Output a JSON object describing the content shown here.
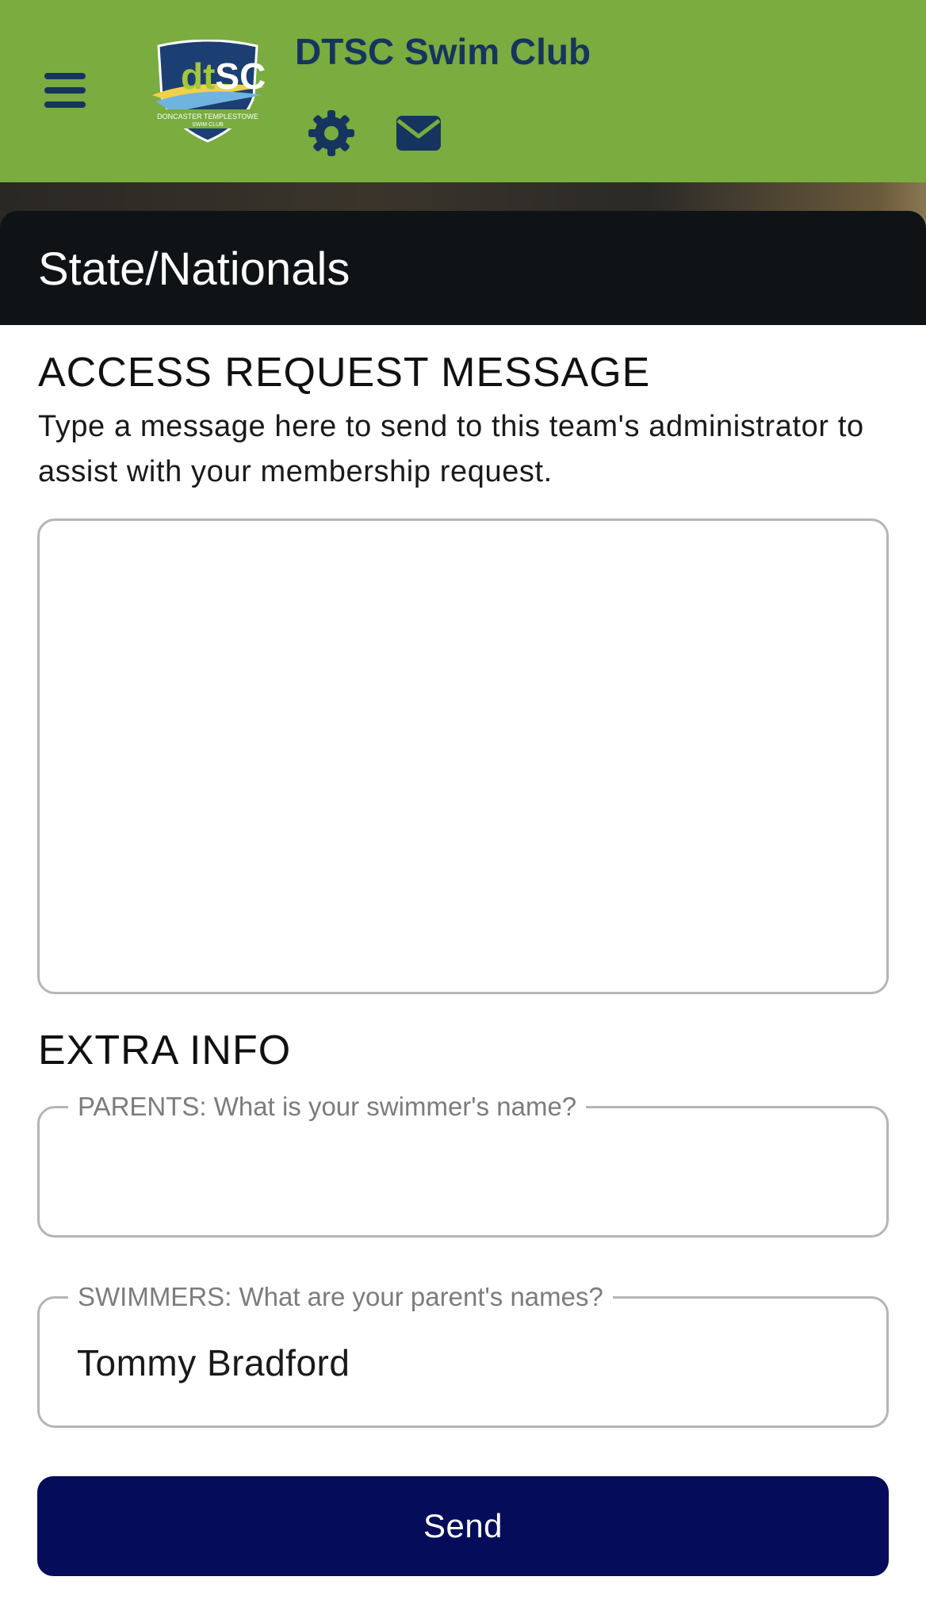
{
  "header": {
    "club_name": "DTSC Swim Club",
    "logo": {
      "initials_lower": "dt",
      "initials_upper": "SC",
      "line1": "DONCASTER TEMPLESTOWE",
      "line2": "SWIM CLUB"
    },
    "icons": {
      "menu": "hamburger-menu-icon",
      "settings": "gear-icon",
      "messages": "envelope-icon"
    }
  },
  "card": {
    "title": "State/Nationals"
  },
  "access_request": {
    "heading": "ACCESS REQUEST MESSAGE",
    "help_text": "Type a message here to send to this team's administrator to assist with your membership request.",
    "message_value": ""
  },
  "extra_info": {
    "heading": "EXTRA INFO",
    "parents_field": {
      "label": "PARENTS: What is your swimmer's name?",
      "value": ""
    },
    "swimmers_field": {
      "label": "SWIMMERS: What are your parent's names?",
      "value": "Tommy Bradford"
    }
  },
  "actions": {
    "send_label": "Send"
  },
  "colors": {
    "header_bg": "#7aac3f",
    "header_text": "#15355e",
    "card_header_bg": "#0f1316",
    "button_bg": "#050d5a"
  }
}
